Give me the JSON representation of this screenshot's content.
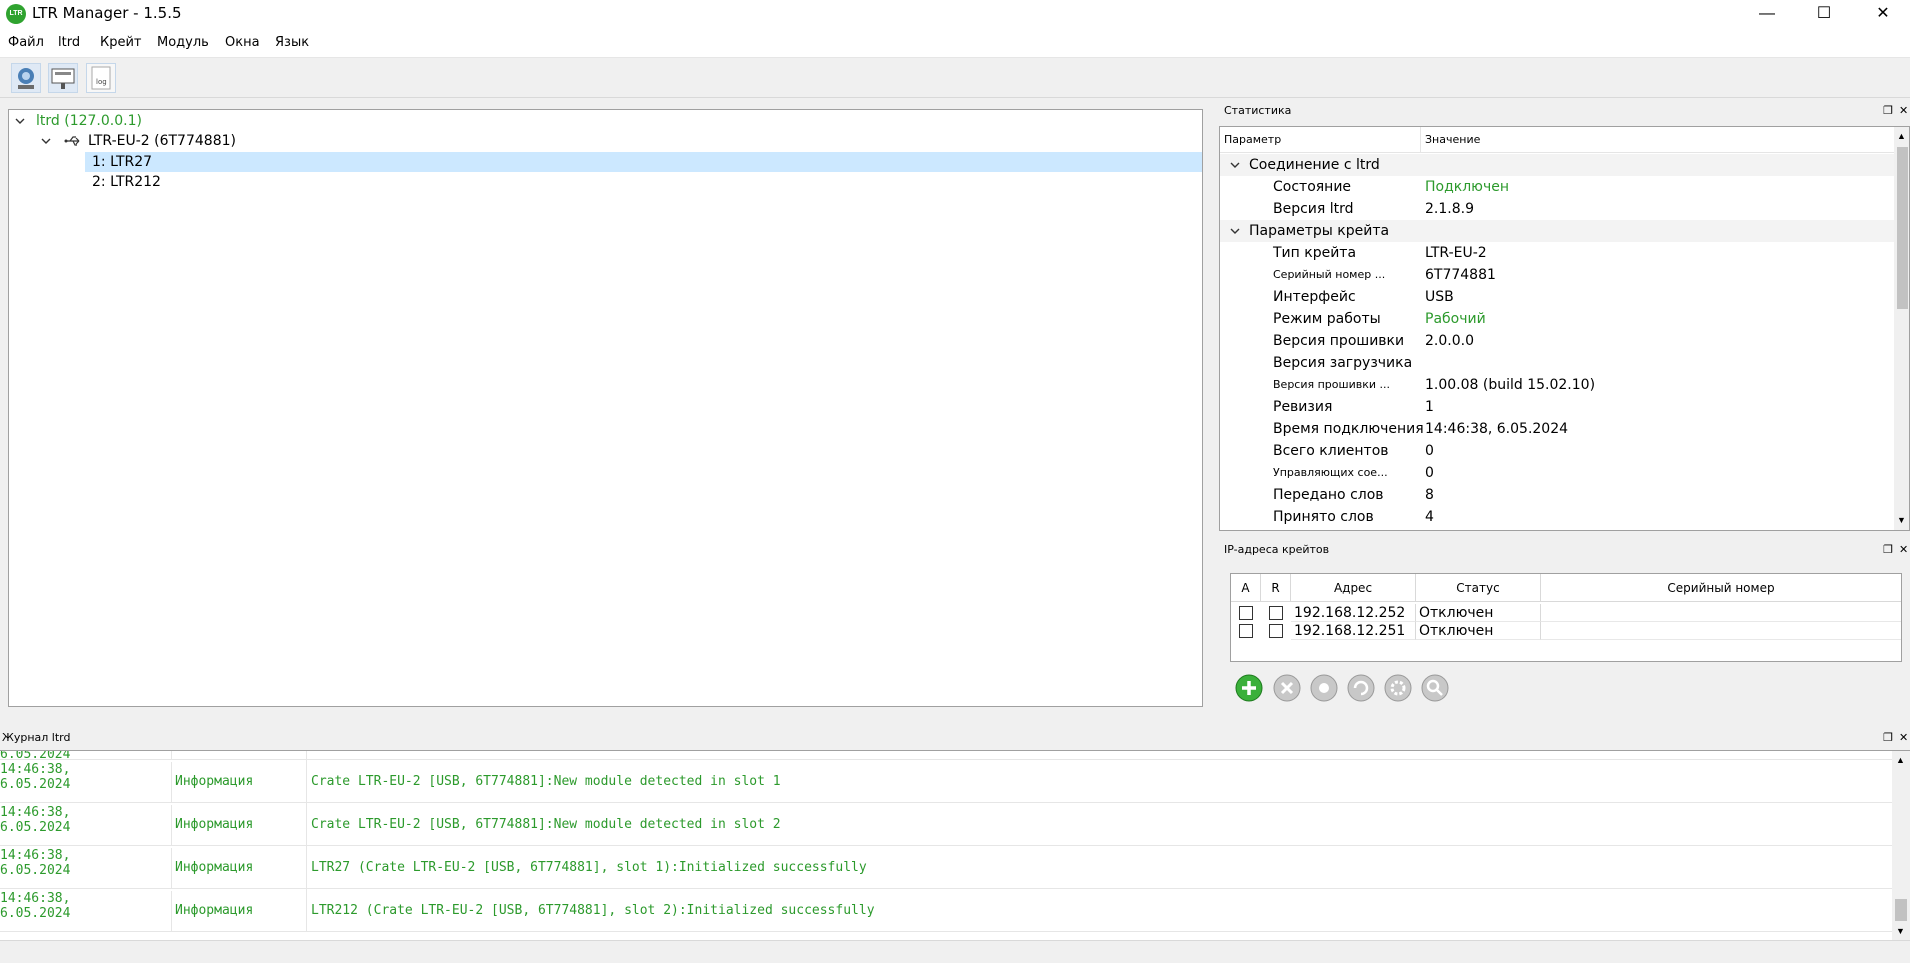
{
  "window": {
    "title": "LTR Manager - 1.5.5",
    "logo_text": "LTR",
    "minimize_glyph": "—",
    "maximize_glyph": "☐",
    "close_glyph": "✕"
  },
  "menu": [
    "Файл",
    "ltrd",
    "Крейт",
    "Модуль",
    "Окна",
    "Язык"
  ],
  "toolbar": {
    "buttons": [
      {
        "icon": "connect-icon"
      },
      {
        "icon": "crate-config-icon"
      },
      {
        "icon": "log-icon",
        "label": "log"
      }
    ]
  },
  "tree": {
    "root": "ltrd (127.0.0.1)",
    "crate": "LTR-EU-2 (6T774881)",
    "modules": [
      "1: LTR27",
      "2: LTR212"
    ]
  },
  "stats": {
    "title": "Статистика",
    "col_param": "Параметр",
    "col_value": "Значение",
    "groups": [
      {
        "name": "Соединение с ltrd",
        "rows": [
          {
            "name": "Состояние",
            "value": "Подключен",
            "green": true
          },
          {
            "name": "Версия ltrd",
            "value": "2.1.8.9"
          }
        ]
      },
      {
        "name": "Параметры крейта",
        "rows": [
          {
            "name": "Тип крейта",
            "value": "LTR-EU-2"
          },
          {
            "name": "Серийный номер ...",
            "value": "6T774881",
            "small": true
          },
          {
            "name": "Интерфейс",
            "value": "USB"
          },
          {
            "name": "Режим работы",
            "value": "Рабочий",
            "green": true
          },
          {
            "name": "Версия прошивки",
            "value": "2.0.0.0"
          },
          {
            "name": "Версия загрузчика",
            "value": ""
          },
          {
            "name": "Версия прошивки ...",
            "value": "1.00.08 (build 15.02.10)",
            "small": true
          },
          {
            "name": "Ревизия",
            "value": "1"
          },
          {
            "name": "Время подключения",
            "value": "14:46:38, 6.05.2024"
          },
          {
            "name": "Всего клиентов",
            "value": "0"
          },
          {
            "name": "Управляющих сое...",
            "value": "0",
            "small": true
          },
          {
            "name": "Передано слов",
            "value": "8"
          },
          {
            "name": "Принято слов",
            "value": "4"
          }
        ]
      }
    ]
  },
  "ip": {
    "title": "IP-адреса крейтов",
    "headers": {
      "a": "A",
      "r": "R",
      "address": "Адрес",
      "status": "Статус",
      "serial": "Серийный номер"
    },
    "rows": [
      {
        "address": "192.168.12.252",
        "status": "Отключен",
        "serial": ""
      },
      {
        "address": "192.168.12.251",
        "status": "Отключен",
        "serial": ""
      }
    ],
    "actions": [
      "add-icon",
      "remove-icon",
      "connect-icon",
      "refresh-icon",
      "settings-icon",
      "search-icon"
    ]
  },
  "log": {
    "title": "Журнал ltrd",
    "rows": [
      {
        "time1": "14:46:38,",
        "time2": "6.05.2024",
        "level": "Информация",
        "message": "Crate LTR-EU-2 [USB, 6T774881]:New module detected in slot 1"
      },
      {
        "time1": "14:46:38,",
        "time2": "6.05.2024",
        "level": "Информация",
        "message": "Crate LTR-EU-2 [USB, 6T774881]:New module detected in slot 2"
      },
      {
        "time1": "14:46:38,",
        "time2": "6.05.2024",
        "level": "Информация",
        "message": "LTR27 (Crate LTR-EU-2 [USB, 6T774881], slot 1):Initialized successfully"
      },
      {
        "time1": "14:46:38,",
        "time2": "6.05.2024",
        "level": "Информация",
        "message": "LTR212 (Crate LTR-EU-2 [USB, 6T774881], slot 2):Initialized successfully"
      }
    ],
    "partial_time": "6.05.2024"
  },
  "colors": {
    "accent_green": "#2c9a2c",
    "selection": "#cce8ff"
  }
}
